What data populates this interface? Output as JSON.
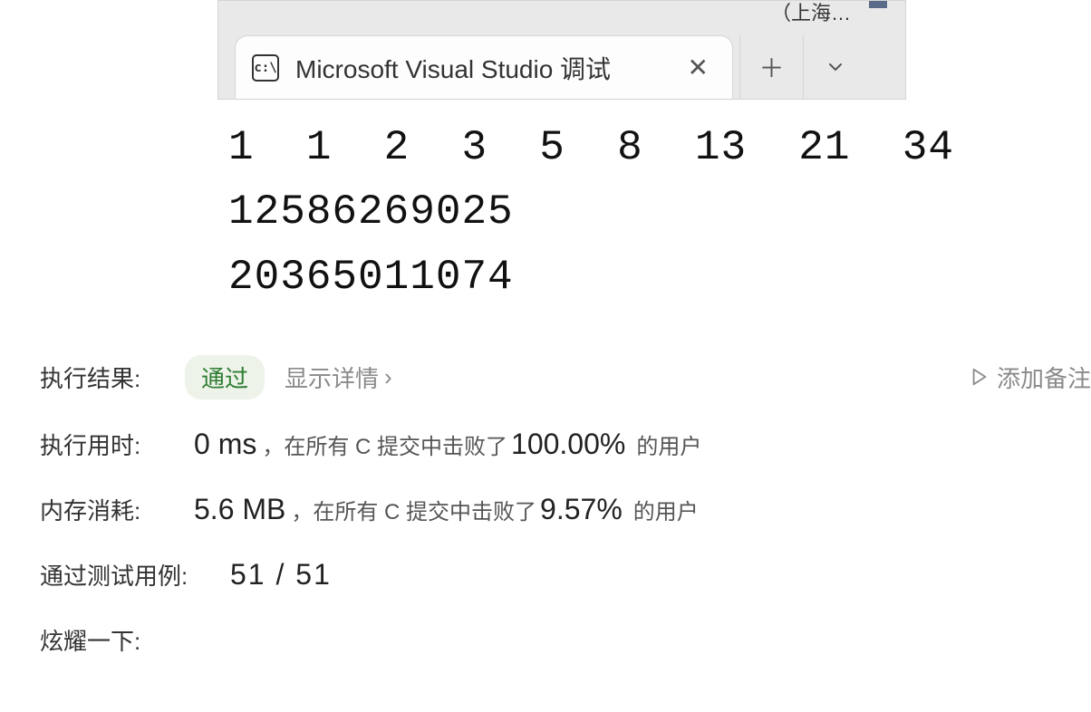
{
  "tab": {
    "icon_text": "c:\\",
    "title": "Microsoft Visual Studio 调试"
  },
  "fragment_top_right": "（上海…",
  "console": {
    "line1": "1  1  2  3  5  8  13  21  34",
    "line2": "12586269025",
    "line3": "20365011074"
  },
  "result": {
    "label": "执行结果:",
    "badge": "通过",
    "details": "显示详情",
    "details_arrow": "›",
    "addnote": "添加备注"
  },
  "runtime": {
    "label": "执行用时:",
    "value": "0 ms",
    "mid": "，在所有 C 提交中击败了",
    "pct": "100.00%",
    "trail": "的用户"
  },
  "memory": {
    "label": "内存消耗:",
    "value": "5.6 MB",
    "mid": "，在所有 C 提交中击败了",
    "pct": "9.57%",
    "trail": "的用户"
  },
  "tests": {
    "label": "通过测试用例:",
    "value": "51 / 51"
  },
  "share": {
    "label": "炫耀一下:"
  }
}
